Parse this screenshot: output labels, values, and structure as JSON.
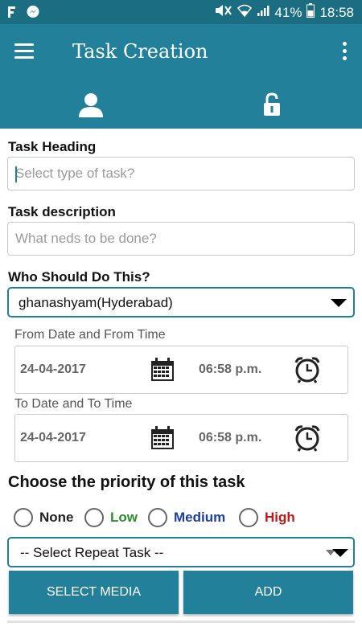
{
  "status_bar": {
    "battery": "41%",
    "time": "18:58",
    "colors": {
      "bg": "#1b6e82"
    }
  },
  "app_bar": {
    "title": "Task Creation",
    "colors": {
      "bg": "#23809a"
    }
  },
  "tabs": [
    {
      "icon": "user-icon"
    },
    {
      "icon": "unlock-icon"
    }
  ],
  "form": {
    "task_heading": {
      "label": "Task Heading",
      "placeholder": "Select type of task?"
    },
    "task_description": {
      "label": "Task description",
      "placeholder": "What neds to be done?"
    },
    "assignee": {
      "label": "Who Should Do This?",
      "value": "ghanashyam(Hyderabad)"
    },
    "from": {
      "label": "From Date and From Time",
      "date": "24-04-2017",
      "time": "06:58 p.m."
    },
    "to": {
      "label": "To Date and To Time",
      "date": "24-04-2017",
      "time": "06:58 p.m."
    },
    "priority": {
      "title": "Choose the priority of this task",
      "options": [
        {
          "label": "None",
          "color": "#222222"
        },
        {
          "label": "Low",
          "color": "#2e8b2e"
        },
        {
          "label": "Medium",
          "color": "#1a3fa0"
        },
        {
          "label": "High",
          "color": "#c01818"
        }
      ]
    },
    "repeat": {
      "value": "-- Select Repeat Task --"
    }
  },
  "buttons": {
    "select_media": "SELECT MEDIA",
    "add": "ADD"
  }
}
